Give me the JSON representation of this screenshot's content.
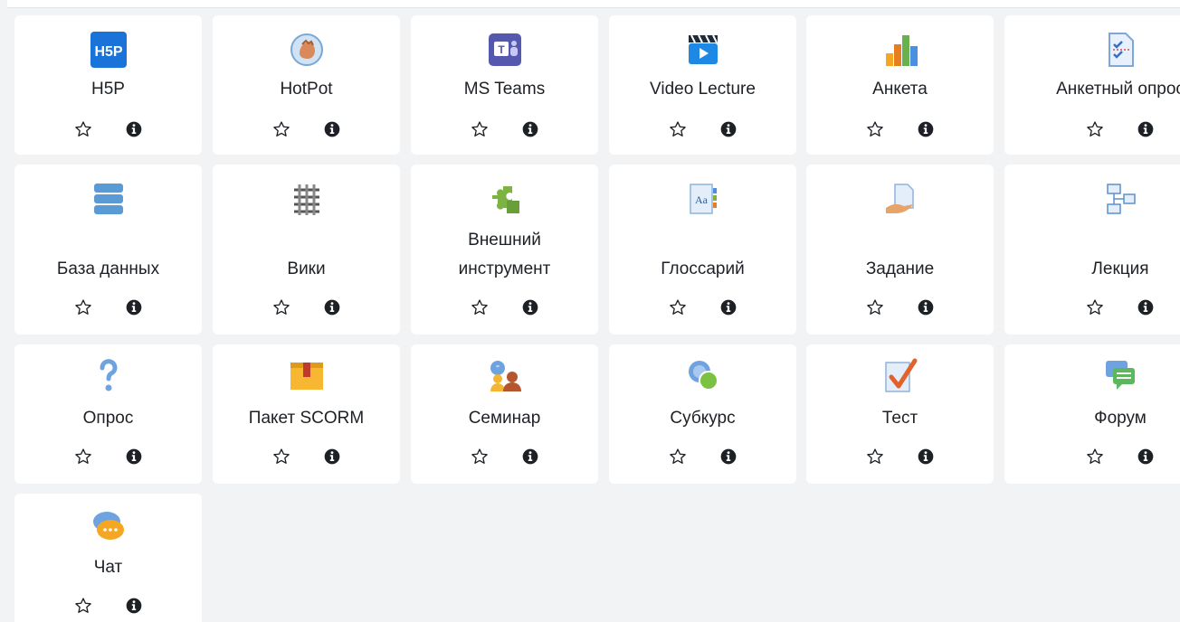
{
  "modules": [
    {
      "label": "H5P",
      "icon": "h5p-icon"
    },
    {
      "label": "HotPot",
      "icon": "hotpot-icon"
    },
    {
      "label": "MS Teams",
      "icon": "ms-teams-icon"
    },
    {
      "label": "Video Lecture",
      "icon": "video-lecture-icon"
    },
    {
      "label": "Анкета",
      "icon": "bar-chart-icon"
    },
    {
      "label": "Анкетный опрос",
      "icon": "survey-checklist-icon"
    },
    {
      "label": "База данных",
      "icon": "database-icon"
    },
    {
      "label": "Вики",
      "icon": "wiki-icon"
    },
    {
      "label": "Внешний инструмент",
      "line1": "Внешний",
      "line2": "инструмент",
      "icon": "puzzle-icon"
    },
    {
      "label": "Глоссарий",
      "icon": "glossary-icon"
    },
    {
      "label": "Задание",
      "icon": "assignment-icon"
    },
    {
      "label": "Лекция",
      "icon": "lesson-flowchart-icon"
    },
    {
      "label": "Опрос",
      "icon": "question-mark-icon"
    },
    {
      "label": "Пакет SCORM",
      "icon": "scorm-package-icon"
    },
    {
      "label": "Семинар",
      "icon": "workshop-people-icon"
    },
    {
      "label": "Субкурс",
      "icon": "subcourse-icon"
    },
    {
      "label": "Тест",
      "icon": "quiz-check-icon"
    },
    {
      "label": "Форум",
      "icon": "forum-icon"
    },
    {
      "label": "Чат",
      "icon": "chat-bubbles-icon"
    }
  ],
  "colors": {
    "background": "#f1f3f5",
    "card": "#ffffff",
    "text": "#1d2125",
    "action_icon": "#1d2125"
  }
}
